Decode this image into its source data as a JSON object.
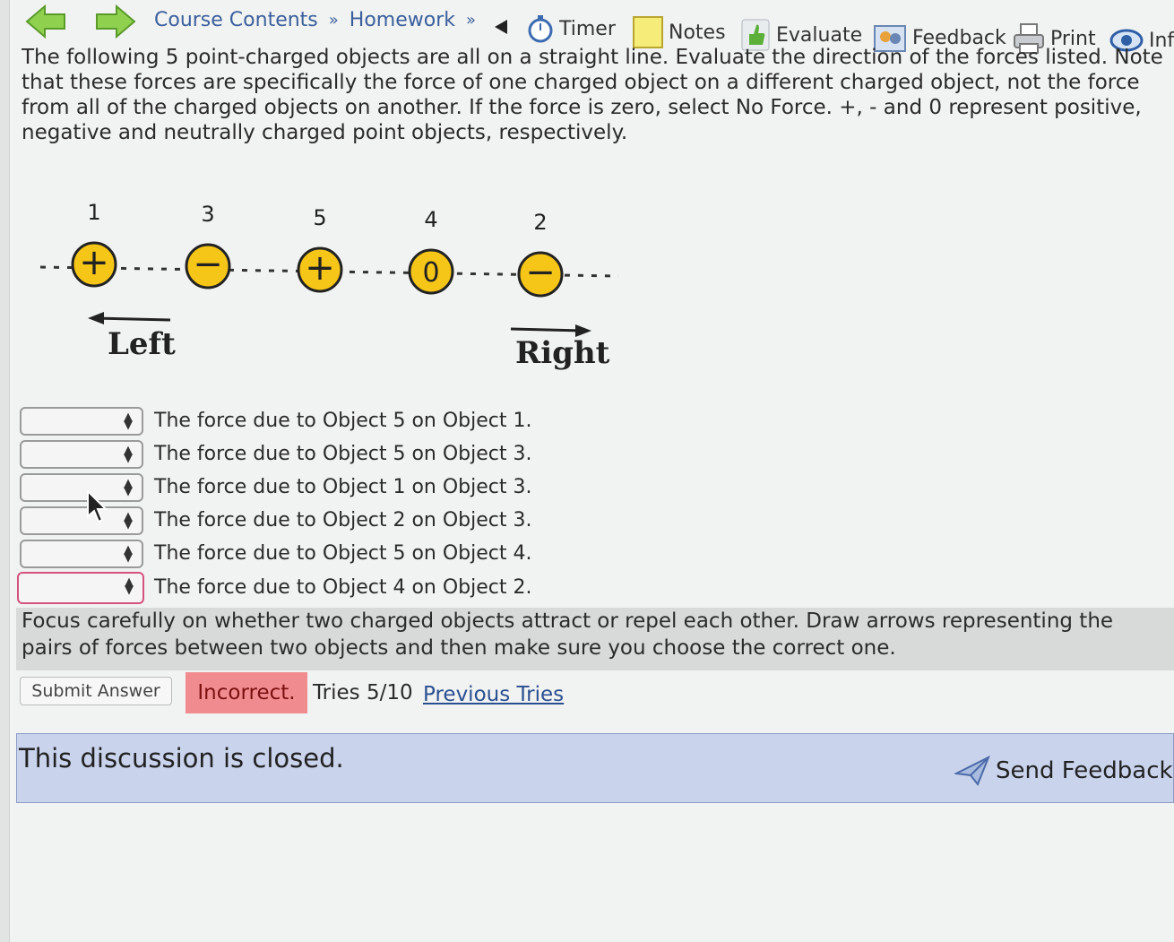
{
  "toolbar": {
    "breadcrumbs": [
      "Course Contents",
      "Homework"
    ],
    "crumb_sep": "»",
    "timer": "Timer",
    "notes": "Notes",
    "evaluate": "Evaluate",
    "feedback": "Feedback",
    "print": "Print",
    "info": "Inf"
  },
  "intro_lines": [
    "The following 5 point-charged objects are all on a straight line. Evaluate the direction of the forces listed. Note",
    "that these forces are specifically the force of one charged object on a different charged object, not the force",
    "from all of the charged objects on another. If the force is zero, select No Force. +, - and 0 represent positive,",
    "negative and neutrally charged point objects, respectively."
  ],
  "diagram": {
    "objects": [
      {
        "number": "1",
        "sign": "+"
      },
      {
        "number": "3",
        "sign": "−"
      },
      {
        "number": "5",
        "sign": "+"
      },
      {
        "number": "4",
        "sign": "0"
      },
      {
        "number": "2",
        "sign": "−"
      }
    ],
    "left_label": "Left",
    "right_label": "Right",
    "charge_fill": "#f5c518"
  },
  "questions": [
    {
      "text": "The force due to Object 5 on Object 1.",
      "selected": ""
    },
    {
      "text": "The force due to Object 5 on Object 3.",
      "selected": ""
    },
    {
      "text": "The force due to Object 1 on Object 3.",
      "selected": ""
    },
    {
      "text": "The force due to Object 2 on Object 3.",
      "selected": ""
    },
    {
      "text": "The force due to Object 5 on Object 4.",
      "selected": ""
    },
    {
      "text": "The force due to Object 4 on Object 2.",
      "selected": ""
    }
  ],
  "hint_lines": [
    "Focus carefully on whether two charged objects attract or repel each other. Draw arrows representing the",
    "pairs of forces between two objects and then make sure you choose the correct one."
  ],
  "submit_label": "Submit Answer",
  "status": "Incorrect.",
  "tries": "Tries 5/10",
  "previous_tries": "Previous Tries",
  "discussion_text": "This discussion is closed.",
  "send_feedback": "Send Feedback",
  "colors": {
    "status_bg": "#f08c90",
    "discussion_bg": "#c9d3ec",
    "link": "#3a5f9c",
    "error_border": "#d4537e"
  }
}
